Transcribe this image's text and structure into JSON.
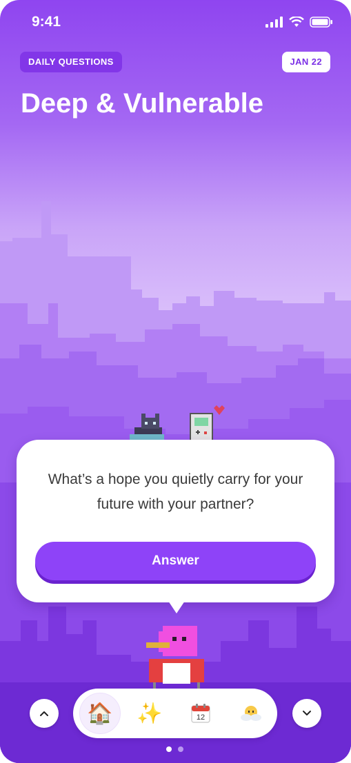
{
  "status_bar": {
    "time": "9:41"
  },
  "header": {
    "section_label": "DAILY QUESTIONS",
    "date": "JAN 22",
    "title": "Deep & Vulnerable"
  },
  "question_card": {
    "question": "What’s a hope you quietly carry for your future with your partner?",
    "answer_label": "Answer"
  },
  "bottom_nav": {
    "items": [
      {
        "icon": "house-icon",
        "glyph": "🏠",
        "active": true
      },
      {
        "icon": "sparkles-icon",
        "glyph": "✨",
        "active": false
      },
      {
        "icon": "calendar-icon",
        "glyph": "12",
        "active": false
      },
      {
        "icon": "weather-face-icon",
        "glyph": "",
        "active": false
      }
    ],
    "page_dots": {
      "count": 2,
      "current": 1
    }
  },
  "colors": {
    "accent": "#8e43f8",
    "accent_dark": "#7b2fe6",
    "text_dark": "#3a3a3a"
  }
}
